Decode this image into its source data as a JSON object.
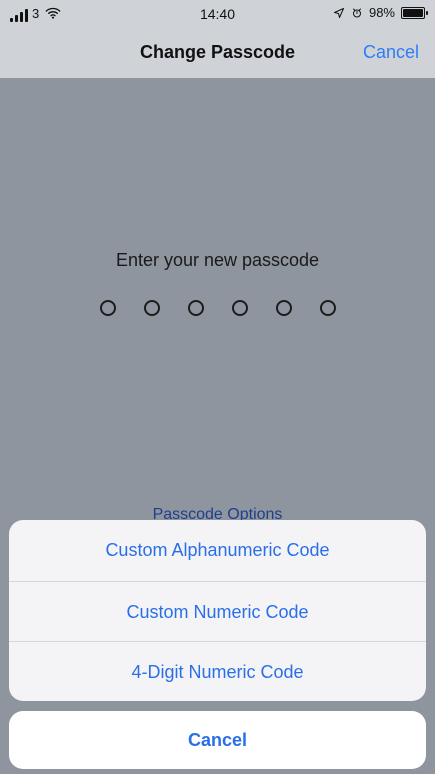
{
  "status_bar": {
    "carrier": "3",
    "time": "14:40",
    "battery": "98%",
    "icons": {
      "signal": "signal-icon",
      "wifi": "wifi-icon",
      "location": "location-arrow-icon",
      "alarm": "alarm-icon",
      "battery": "battery-icon"
    }
  },
  "nav": {
    "title": "Change Passcode",
    "cancel_label": "Cancel"
  },
  "main": {
    "prompt": "Enter your new passcode",
    "passcode_options_label": "Passcode Options"
  },
  "sheet": {
    "options": [
      {
        "label": "Custom Alphanumeric Code"
      },
      {
        "label": "Custom Numeric Code"
      },
      {
        "label": "4-Digit Numeric Code"
      }
    ],
    "cancel_label": "Cancel"
  },
  "colors": {
    "accent_blue": "#2A6FE8",
    "dimmed_background": "#8E959E",
    "status_bar_background": "#CFD3D8"
  }
}
